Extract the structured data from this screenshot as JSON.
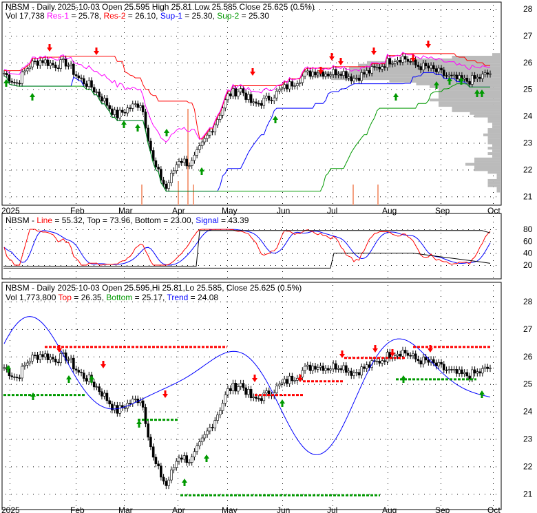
{
  "chart_data": [
    {
      "type": "candlestick",
      "title": "NBSM - Daily 2025-10-03 Open 25.595  High 25.81  Low 25.585  Close 25.625 (0.5%)",
      "legend": [
        {
          "label": "Vol 17,738",
          "color": "#000000"
        },
        {
          "label": "Res-1",
          "value": "25.78",
          "color": "#ff00ff"
        },
        {
          "label": "Res-2",
          "value": "26.10",
          "color": "#ff0000"
        },
        {
          "label": "Sup-1",
          "value": "25.30",
          "color": "#0000ff"
        },
        {
          "label": "Sup-2",
          "value": "25.30",
          "color": "#009900"
        }
      ],
      "ylim": [
        20.7,
        28.2
      ],
      "yticks": [
        21,
        22,
        23,
        24,
        25,
        26,
        27,
        28
      ],
      "xticks": [
        "2025",
        "Feb",
        "Mar",
        "Apr",
        "May",
        "Jun",
        "Jul",
        "Aug",
        "Sep",
        "Oct"
      ],
      "weekly_close": [
        25.6,
        25.2,
        25.9,
        26.1,
        25.9,
        26.0,
        25.4,
        25.1,
        24.6,
        24.0,
        24.3,
        24.5,
        22.2,
        21.3,
        22.4,
        22.2,
        23.0,
        23.8,
        24.8,
        25.0,
        24.4,
        24.6,
        24.9,
        25.2,
        25.5,
        25.7,
        25.6,
        25.7,
        25.4,
        25.6,
        25.8,
        26.1,
        26.2,
        25.9,
        25.8,
        25.6,
        25.4,
        25.3,
        25.4,
        25.6
      ]
    },
    {
      "type": "line",
      "title": "NBSM - Line = 55.32, Top = 73.96, Bottom = 23.00, Signal = 43.39",
      "legend": [
        {
          "label": "Line",
          "value": "55.32",
          "color": "#ff0000"
        },
        {
          "label": "Top",
          "value": "73.96",
          "color": "#000000"
        },
        {
          "label": "Bottom",
          "value": "23.00",
          "color": "#000000"
        },
        {
          "label": "Signal",
          "value": "43.39",
          "color": "#0000ff"
        }
      ],
      "ylim": [
        0,
        95
      ],
      "yticks": [
        20,
        40,
        60,
        80
      ]
    },
    {
      "type": "candlestick",
      "title": "NBSM - Daily 2025-10-03 Open 25.595,Hi 25.81,Lo 25.585, Close 25.625 (0.5%)",
      "legend": [
        {
          "label": "Vol 1,773,800",
          "color": "#000000"
        },
        {
          "label": "Top",
          "value": "26.35",
          "color": "#ff0000"
        },
        {
          "label": "Bottom",
          "value": "25.17",
          "color": "#009900"
        },
        {
          "label": "Trend",
          "value": "24.08",
          "color": "#0000ff"
        }
      ],
      "ylim": [
        20.7,
        28.4
      ],
      "yticks": [
        21,
        22,
        23,
        24,
        25,
        26,
        27,
        28
      ],
      "xticks": [
        "2025",
        "Feb",
        "Mar",
        "Apr",
        "May",
        "Jun",
        "Jul",
        "Aug",
        "Sep",
        "Oct"
      ]
    }
  ],
  "labels": {
    "p1_title": "NBSM - Daily 2025-10-03 Open 25.595  High 25.81  Low 25.585  Close 25.625 (0.5%)",
    "p1_vol": "Vol 17,738",
    "p1_res1": "Res-1",
    "p1_res1v": " = 25.78, ",
    "p1_res2": "Res-2",
    "p1_res2v": " = 26.10, ",
    "p1_sup1": "Sup-1",
    "p1_sup1v": " = 25.30, ",
    "p1_sup2": "Sup-2",
    "p1_sup2v": " = 25.30",
    "p2_pre": "NBSM - ",
    "p2_line": "Line",
    "p2_mid": " = 55.32, Top = 73.96, Bottom = 23.00, ",
    "p2_sig": "Signal",
    "p2_sigv": " = 43.39",
    "p3_title": "NBSM - Daily 2025-10-03 Open 25.595,Hi 25.81,Lo 25.585, Close 25.625 (0.5%)",
    "p3_vol": "Vol 1,773,800 ",
    "p3_top": "Top",
    "p3_topv": " = 26.35, ",
    "p3_bot": "Bottom",
    "p3_botv": " = 25.17, ",
    "p3_trend": "Trend",
    "p3_trendv": " = 24.08"
  }
}
